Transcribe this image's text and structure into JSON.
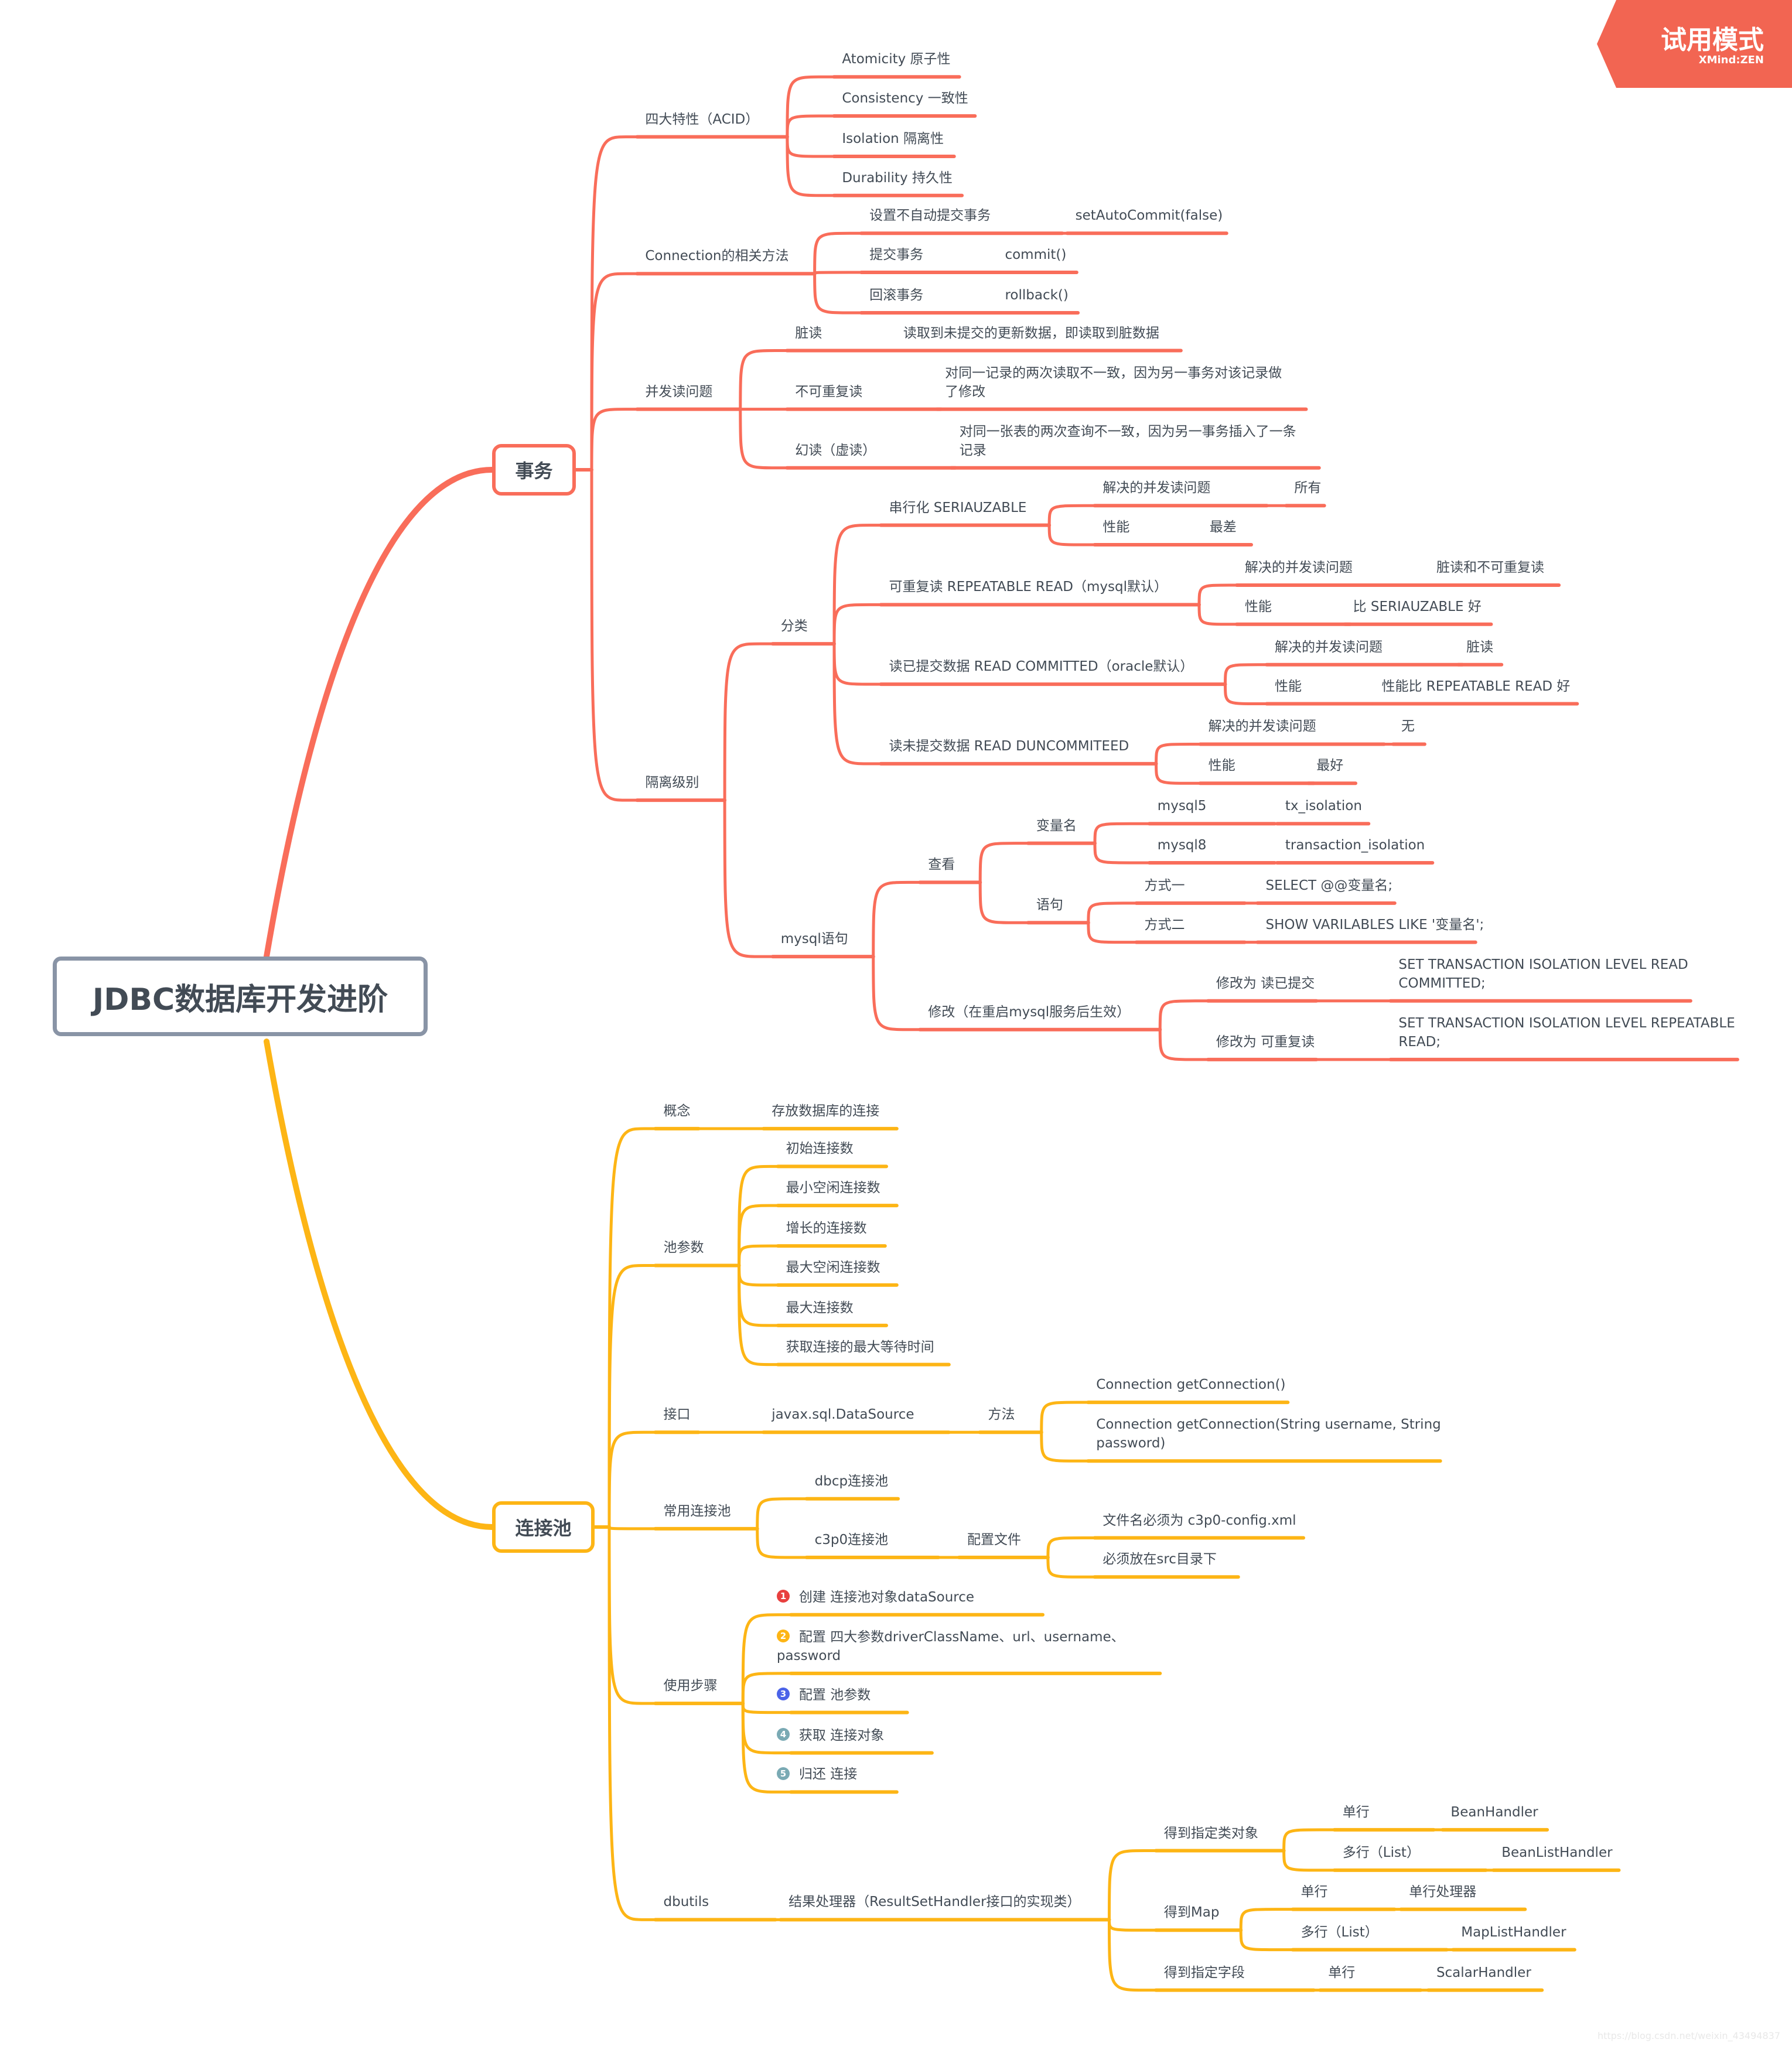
{
  "central": "JDBC数据库开发进阶",
  "badge": {
    "title": "试用模式",
    "subtitle": "XMind:ZEN"
  },
  "watermark": "https://blog.csdn.net/weixin_43494837",
  "colors": {
    "transaction": "#f96d5a",
    "pool": "#fdb515",
    "central_border": "#8994a6",
    "text": "#424b55",
    "badge": "#f26552"
  },
  "branches": {
    "transaction": {
      "label": "事务"
    },
    "pool": {
      "label": "连接池"
    }
  },
  "nodes": {
    "t1": "四大特性（ACID）",
    "t1a": "Atomicity 原子性",
    "t1b": "Consistency 一致性",
    "t1c": "Isolation 隔离性",
    "t1d": "Durability 持久性",
    "t2": "Connection的相关方法",
    "t2a": "设置不自动提交事务",
    "t2a1": "setAutoCommit(false)",
    "t2b": "提交事务",
    "t2b1": "commit()",
    "t2c": "回滚事务",
    "t2c1": "rollback()",
    "t3": "并发读问题",
    "t3a": "脏读",
    "t3a1": "读取到未提交的更新数据，即读取到脏数据",
    "t3b": "不可重复读",
    "t3b1": "对同一记录的两次读取不一致，因为另一事务对该记录做\n了修改",
    "t3c": "幻读（虚读）",
    "t3c1": "对同一张表的两次查询不一致，因为另一事务插入了一条\n记录",
    "t4": "隔离级别",
    "t4a": "分类",
    "t4a1": "串行化 SERIAUZABLE",
    "t4a1a": "解决的并发读问题",
    "t4a1a1": "所有",
    "t4a1b": "性能",
    "t4a1b1": "最差",
    "t4a2": "可重复读 REPEATABLE READ（mysql默认）",
    "t4a2a": "解决的并发读问题",
    "t4a2a1": "脏读和不可重复读",
    "t4a2b": "性能",
    "t4a2b1": "比 SERIAUZABLE 好",
    "t4a3": "读已提交数据 READ COMMITTED（oracle默认）",
    "t4a3a": "解决的并发读问题",
    "t4a3a1": "脏读",
    "t4a3b": "性能",
    "t4a3b1": "性能比 REPEATABLE READ 好",
    "t4a4": "读未提交数据 READ DUNCOMMITEED",
    "t4a4a": "解决的并发读问题",
    "t4a4a1": "无",
    "t4a4b": "性能",
    "t4a4b1": "最好",
    "t4b": "mysql语句",
    "t4b1": "查看",
    "t4b1a": "变量名",
    "t4b1a1": "mysql5",
    "t4b1a1a": "tx_isolation",
    "t4b1a2": "mysql8",
    "t4b1a2a": "transaction_isolation",
    "t4b1b": "语句",
    "t4b1b1": "方式一",
    "t4b1b1a": "SELECT @@变量名;",
    "t4b1b2": "方式二",
    "t4b1b2a": "SHOW VARILABLES LIKE '变量名';",
    "t4b2": "修改（在重启mysql服务后生效）",
    "t4b2a": "修改为 读已提交",
    "t4b2a1": "SET TRANSACTION ISOLATION LEVEL READ\nCOMMITTED;",
    "t4b2b": "修改为 可重复读",
    "t4b2b1": "SET TRANSACTION ISOLATION LEVEL REPEATABLE\nREAD;",
    "p1": "概念",
    "p1a": "存放数据库的连接",
    "p2": "池参数",
    "p2a": "初始连接数",
    "p2b": "最小空闲连接数",
    "p2c": "增长的连接数",
    "p2d": "最大空闲连接数",
    "p2e": "最大连接数",
    "p2f": "获取连接的最大等待时间",
    "p3": "接口",
    "p3a": "javax.sql.DataSource",
    "p3a1": "方法",
    "p3a1a": "Connection getConnection()",
    "p3a1b": "Connection getConnection(String username, String\npassword)",
    "p4": "常用连接池",
    "p4a": "dbcp连接池",
    "p4b": "c3p0连接池",
    "p4b1": "配置文件",
    "p4b1a": "文件名必须为 c3p0-config.xml",
    "p4b1b": "必须放在src目录下",
    "p5": "使用步骤",
    "p5a": "创建 连接池对象dataSource",
    "p5b": "配置 四大参数driverClassName、url、username、\npassword",
    "p5c": "配置 池参数",
    "p5d": "获取 连接对象",
    "p5e": "归还 连接",
    "p6": "dbutils",
    "p6a": "结果处理器（ResultSetHandler接口的实现类）",
    "p6a1": "得到指定类对象",
    "p6a1a": "单行",
    "p6a1a1": "BeanHandler",
    "p6a1b": "多行（List）",
    "p6a1b1": "BeanListHandler",
    "p6a2": "得到Map",
    "p6a2a": "单行",
    "p6a2a1": "单行处理器",
    "p6a2b": "多行（List）",
    "p6a2b1": "MapListHandler",
    "p6a3": "得到指定字段",
    "p6a3a": "单行",
    "p6a3a1": "ScalarHandler"
  },
  "step_markers": {
    "p5a": {
      "num": "1",
      "color": "#e8403f"
    },
    "p5b": {
      "num": "2",
      "color": "#fdb515"
    },
    "p5c": {
      "num": "3",
      "color": "#4b63e8"
    },
    "p5d": {
      "num": "4",
      "color": "#7aaab4"
    },
    "p5e": {
      "num": "5",
      "color": "#7aaab4"
    }
  }
}
